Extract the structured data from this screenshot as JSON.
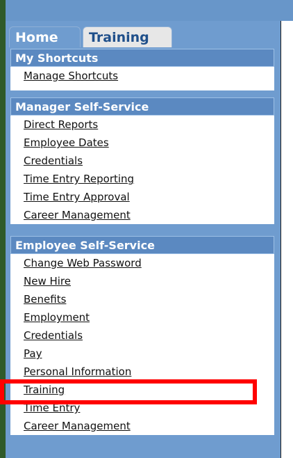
{
  "tabs": [
    {
      "label": "Home"
    },
    {
      "label": "Training"
    }
  ],
  "sections": {
    "shortcuts": {
      "title": "My Shortcuts",
      "items": [
        "Manage Shortcuts"
      ]
    },
    "manager": {
      "title": "Manager Self-Service",
      "items": [
        "Direct Reports",
        "Employee Dates",
        "Credentials",
        "Time Entry Reporting",
        "Time Entry Approval",
        "Career Management"
      ]
    },
    "employee": {
      "title": "Employee Self-Service",
      "items": [
        "Change Web Password",
        "New Hire",
        "Benefits",
        "Employment",
        "Credentials",
        "Pay",
        "Personal Information",
        "Training",
        "Time Entry",
        "Career Management"
      ]
    }
  },
  "highlight": {
    "target": "Training",
    "color": "#ff0000"
  }
}
